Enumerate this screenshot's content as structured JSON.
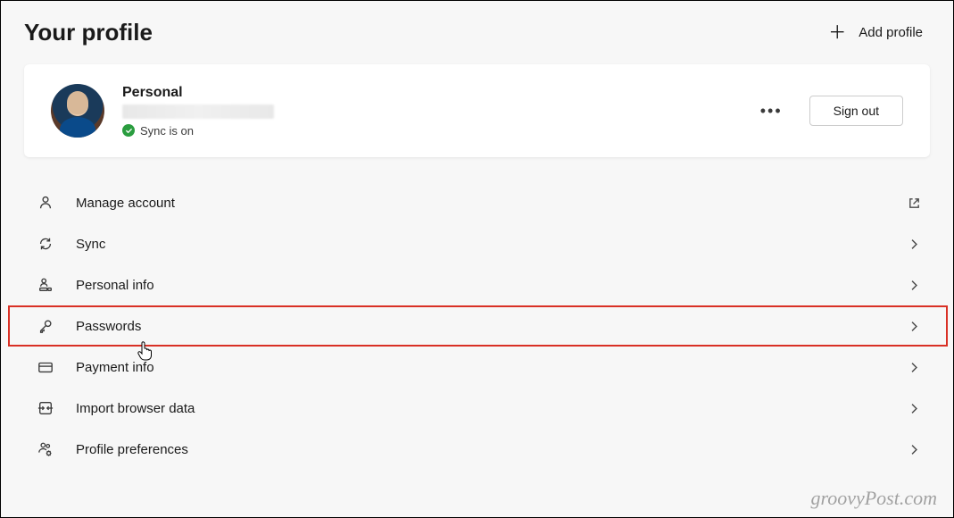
{
  "header": {
    "title": "Your profile",
    "add_profile_label": "Add profile"
  },
  "profile": {
    "name": "Personal",
    "email_redacted": true,
    "sync_status": "Sync is on",
    "more_label": "More options",
    "signout_label": "Sign out"
  },
  "settings": [
    {
      "icon": "person-icon",
      "label": "Manage account",
      "action": "external"
    },
    {
      "icon": "sync-icon",
      "label": "Sync",
      "action": "drill"
    },
    {
      "icon": "personal-info-icon",
      "label": "Personal info",
      "action": "drill"
    },
    {
      "icon": "key-icon",
      "label": "Passwords",
      "action": "drill",
      "highlighted": true
    },
    {
      "icon": "card-icon",
      "label": "Payment info",
      "action": "drill"
    },
    {
      "icon": "import-icon",
      "label": "Import browser data",
      "action": "drill"
    },
    {
      "icon": "people-gear-icon",
      "label": "Profile preferences",
      "action": "drill"
    }
  ],
  "watermark": "groovyPost.com"
}
